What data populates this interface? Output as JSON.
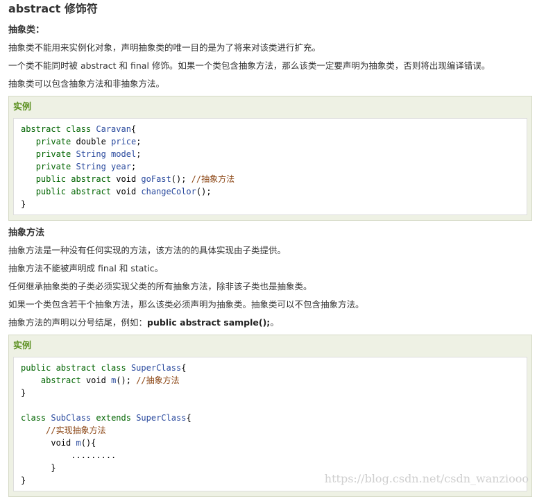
{
  "title": "abstract 修饰符",
  "section1": {
    "heading": "抽象类：",
    "paragraphs": [
      "抽象类不能用来实例化对象，声明抽象类的唯一目的是为了将来对该类进行扩充。",
      "一个类不能同时被 abstract 和 final 修饰。如果一个类包含抽象方法，那么该类一定要声明为抽象类，否则将出现编译错误。",
      "抽象类可以包含抽象方法和非抽象方法。"
    ]
  },
  "example1": {
    "label": "实例",
    "lines": [
      [
        [
          "kw",
          "abstract class "
        ],
        [
          "ty",
          "Caravan"
        ],
        [
          "",
          "{"
        ]
      ],
      [
        [
          "",
          "   "
        ],
        [
          "kw",
          "private "
        ],
        [
          "",
          "double "
        ],
        [
          "ty",
          "price"
        ],
        [
          "",
          "; "
        ]
      ],
      [
        [
          "",
          "   "
        ],
        [
          "kw",
          "private "
        ],
        [
          "ty",
          "String model"
        ],
        [
          "",
          ";"
        ]
      ],
      [
        [
          "",
          "   "
        ],
        [
          "kw",
          "private "
        ],
        [
          "ty",
          "String year"
        ],
        [
          "",
          ";"
        ]
      ],
      [
        [
          "",
          "   "
        ],
        [
          "kw",
          "public abstract "
        ],
        [
          "",
          "void "
        ],
        [
          "fn",
          "goFast"
        ],
        [
          "",
          "(); "
        ],
        [
          "cm",
          "//抽象方法"
        ]
      ],
      [
        [
          "",
          "   "
        ],
        [
          "kw",
          "public abstract "
        ],
        [
          "",
          "void "
        ],
        [
          "fn",
          "changeColor"
        ],
        [
          "",
          "();"
        ]
      ],
      [
        [
          "",
          "}"
        ]
      ]
    ]
  },
  "section2": {
    "heading": "抽象方法",
    "paragraphs": [
      "抽象方法是一种没有任何实现的方法，该方法的的具体实现由子类提供。",
      "抽象方法不能被声明成 final 和 static。",
      "任何继承抽象类的子类必须实现父类的所有抽象方法，除非该子类也是抽象类。",
      "如果一个类包含若干个抽象方法，那么该类必须声明为抽象类。抽象类可以不包含抽象方法。"
    ],
    "last_prefix": "抽象方法的声明以分号结尾，例如：",
    "last_bold": "public abstract sample();",
    "last_suffix": "。"
  },
  "example2": {
    "label": "实例",
    "lines": [
      [
        [
          "kw",
          "public abstract class "
        ],
        [
          "ty",
          "SuperClass"
        ],
        [
          "",
          "{"
        ]
      ],
      [
        [
          "",
          "    "
        ],
        [
          "kw",
          "abstract "
        ],
        [
          "",
          "void "
        ],
        [
          "fn",
          "m"
        ],
        [
          "",
          "(); "
        ],
        [
          "cm",
          "//抽象方法"
        ]
      ],
      [
        [
          "",
          "}"
        ]
      ],
      [
        [
          "",
          ""
        ]
      ],
      [
        [
          "kw",
          "class "
        ],
        [
          "ty",
          "SubClass "
        ],
        [
          "kw",
          "extends "
        ],
        [
          "ty",
          "SuperClass"
        ],
        [
          "",
          "{"
        ]
      ],
      [
        [
          "",
          "     "
        ],
        [
          "cm",
          "//实现抽象方法"
        ]
      ],
      [
        [
          "",
          "      "
        ],
        [
          "",
          "void "
        ],
        [
          "fn",
          "m"
        ],
        [
          "",
          "(){"
        ]
      ],
      [
        [
          "",
          "          ........."
        ]
      ],
      [
        [
          "",
          "      }"
        ]
      ],
      [
        [
          "",
          "}"
        ]
      ]
    ]
  },
  "watermark": "https://blog.csdn.net/csdn_wanziooo"
}
